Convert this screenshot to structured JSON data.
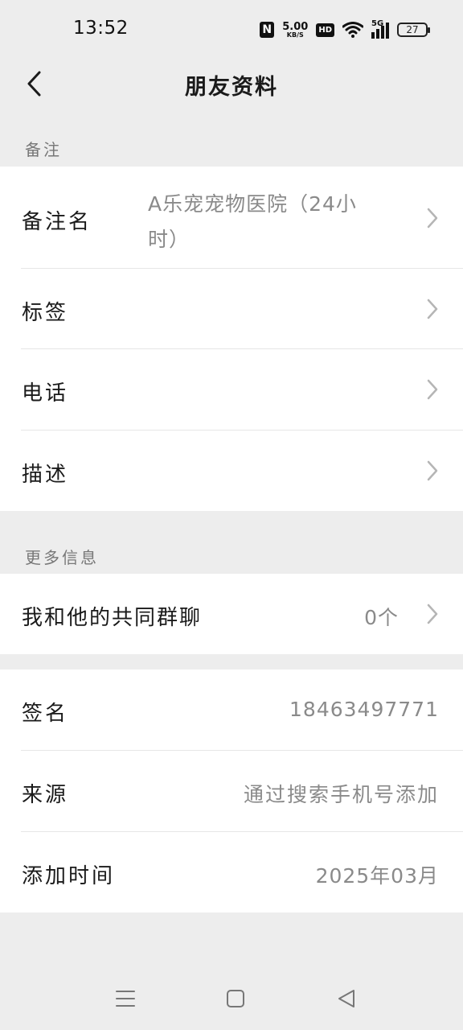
{
  "status_bar": {
    "time": "13:52",
    "nfc": "N",
    "speed_value": "5.00",
    "speed_unit": "KB/S",
    "hd": "HD",
    "network": "5G",
    "battery": "27"
  },
  "header": {
    "title": "朋友资料"
  },
  "remarks_section": {
    "label": "备注",
    "rows": [
      {
        "label": "备注名",
        "value_line1": "A乐宠宠物医院（24小",
        "value_line2": "时）"
      },
      {
        "label": "标签",
        "value": ""
      },
      {
        "label": "电话",
        "value": ""
      },
      {
        "label": "描述",
        "value": ""
      }
    ]
  },
  "more_info_section": {
    "label": "更多信息",
    "common_groups": {
      "label": "我和他的共同群聊",
      "value": "0个"
    }
  },
  "details": {
    "rows": [
      {
        "label": "签名",
        "value": "18463497771"
      },
      {
        "label": "来源",
        "value": "通过搜索手机号添加"
      },
      {
        "label": "添加时间",
        "value": "2025年03月"
      }
    ]
  },
  "icons": {
    "back": "chevron-left-icon",
    "row_arrow": "chevron-right-icon",
    "menu": "menu-icon",
    "home": "home-square-icon",
    "back_nav": "back-triangle-icon"
  },
  "colors": {
    "background": "#ededed",
    "card": "#ffffff",
    "secondary_text": "#8a8a8a"
  }
}
